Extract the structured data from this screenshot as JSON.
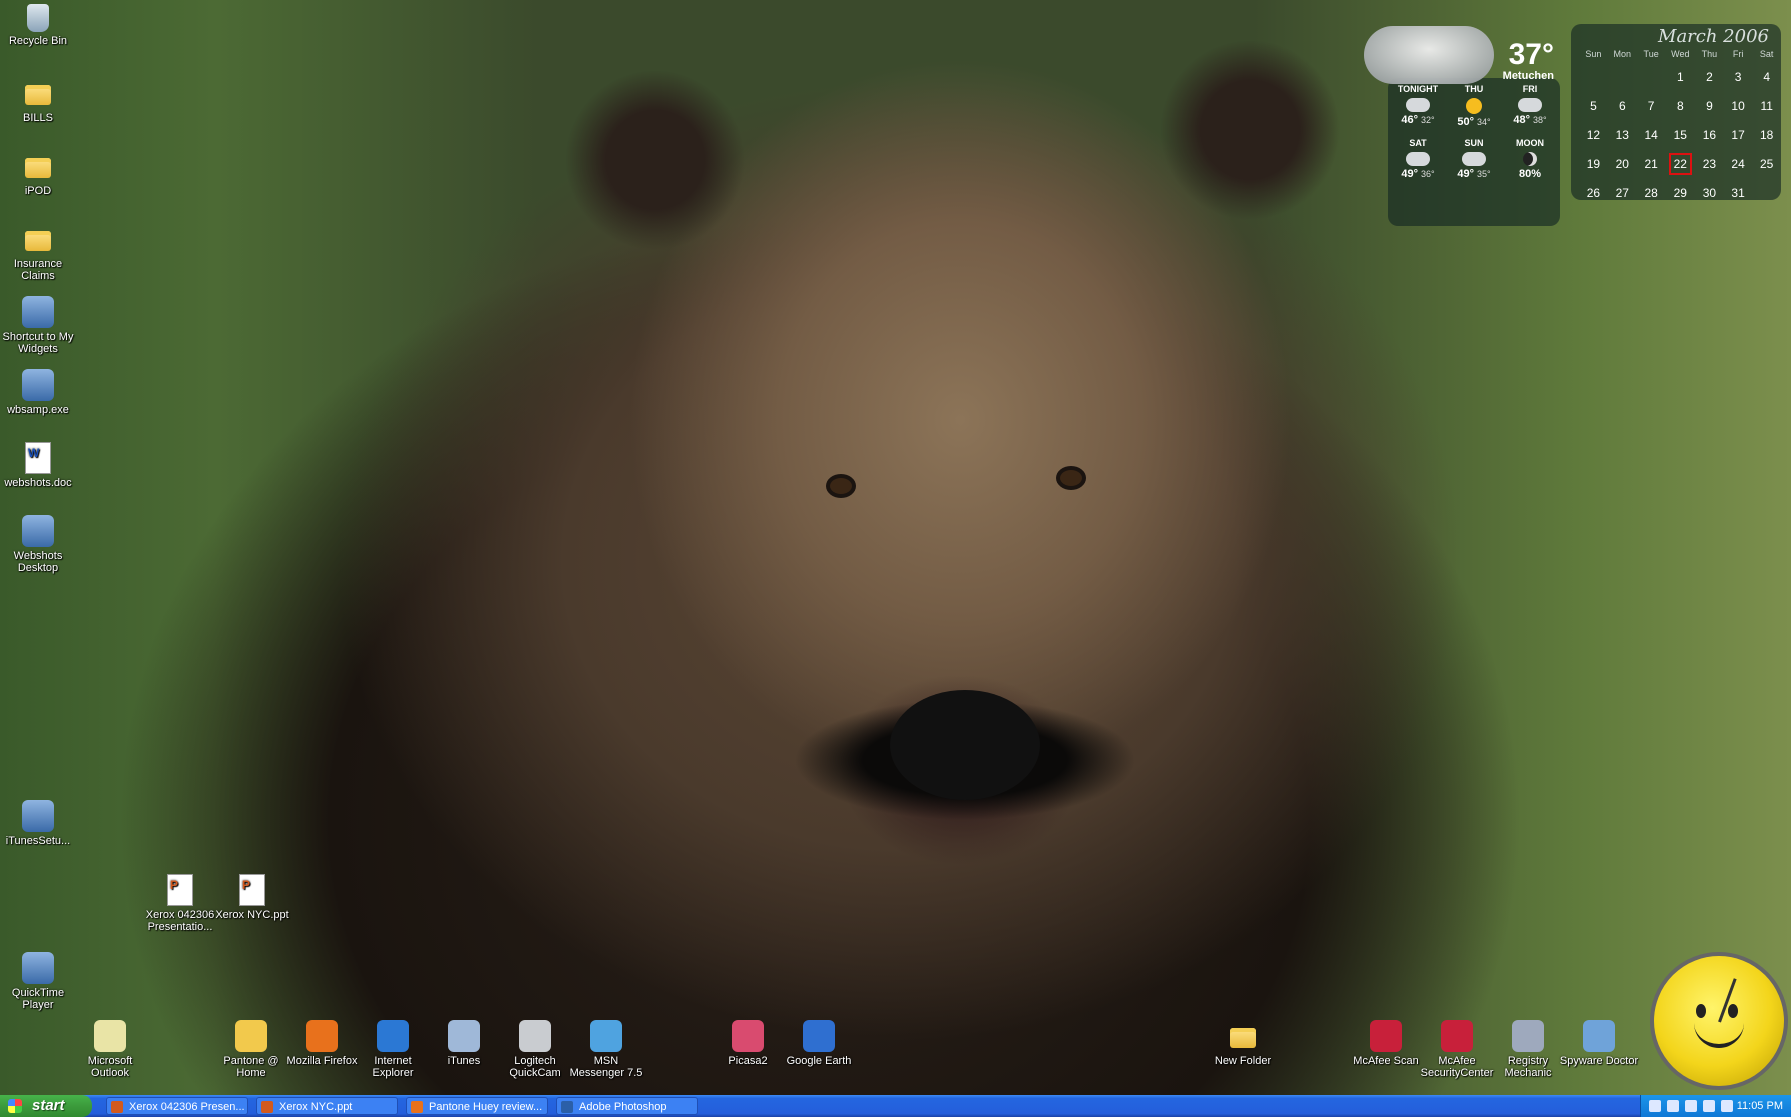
{
  "desktop_left": [
    {
      "name": "recycle-bin",
      "label": "Recycle Bin",
      "kind": "bin"
    },
    {
      "name": "bills-folder",
      "label": "BILLS",
      "kind": "folder"
    },
    {
      "name": "ipod-folder",
      "label": "iPOD",
      "kind": "folder"
    },
    {
      "name": "insurance-claims-folder",
      "label": "Insurance Claims",
      "kind": "folder"
    },
    {
      "name": "my-widgets-shortcut",
      "label": "Shortcut to My Widgets",
      "kind": "app"
    },
    {
      "name": "wbsamp-exe",
      "label": "wbsamp.exe",
      "kind": "app"
    },
    {
      "name": "websots-doc",
      "label": "webshots.doc",
      "kind": "doc-word"
    },
    {
      "name": "webshots-desktop",
      "label": "Webshots Desktop",
      "kind": "app"
    },
    {
      "name": "itunes-setup",
      "label": "iTunesSetu...",
      "kind": "app"
    },
    {
      "name": "quicktime-player",
      "label": "QuickTime Player",
      "kind": "app"
    }
  ],
  "desktop_files": [
    {
      "name": "xerox-042306-presentation",
      "label": "Xerox 042306 Presentatio...",
      "kind": "doc-ppt"
    },
    {
      "name": "xerox-nyc-ppt",
      "label": "Xerox NYC.ppt",
      "kind": "doc-ppt"
    }
  ],
  "desktop_bottom": [
    {
      "name": "microsoft-outlook",
      "label": "Microsoft Outlook",
      "color": "#e9e4a6"
    },
    {
      "name": "pantone-at-home",
      "label": "Pantone @ Home",
      "color": "#f2c94c"
    },
    {
      "name": "mozilla-firefox",
      "label": "Mozilla Firefox",
      "color": "#e8711c"
    },
    {
      "name": "internet-explorer",
      "label": "Internet Explorer",
      "color": "#2b78d4"
    },
    {
      "name": "itunes",
      "label": "iTunes",
      "color": "#9fb8d8"
    },
    {
      "name": "logitech-quickcam",
      "label": "Logitech QuickCam",
      "color": "#c9ccd0"
    },
    {
      "name": "msn-messenger",
      "label": "MSN Messenger 7.5",
      "color": "#4fa3e0"
    },
    {
      "name": "picasa2",
      "label": "Picasa2",
      "color": "#d94b6f"
    },
    {
      "name": "google-earth",
      "label": "Google Earth",
      "color": "#2f6fd0"
    },
    {
      "name": "new-folder",
      "label": "New Folder",
      "color": "#f0c83c"
    },
    {
      "name": "mcafee-scan",
      "label": "McAfee Scan",
      "color": "#c8203a"
    },
    {
      "name": "mcafee-securitycenter",
      "label": "McAfee SecurityCenter",
      "color": "#c8203a"
    },
    {
      "name": "registry-mechanic",
      "label": "Registry Mechanic",
      "color": "#9ea9bd"
    },
    {
      "name": "spyware-doctor",
      "label": "Spyware Doctor",
      "color": "#6fa3d9"
    }
  ],
  "weather": {
    "temp": "37°",
    "location": "Metuchen",
    "days": [
      {
        "label": "TONIGHT",
        "icon": "cloud-icon",
        "hi": "46°",
        "lo": "32°"
      },
      {
        "label": "THU",
        "icon": "sun-icon",
        "hi": "50°",
        "lo": "34°"
      },
      {
        "label": "FRI",
        "icon": "cloud-icon",
        "hi": "48°",
        "lo": "38°"
      },
      {
        "label": "SAT",
        "icon": "cloud-icon",
        "hi": "49°",
        "lo": "36°"
      },
      {
        "label": "SUN",
        "icon": "rain-icon",
        "hi": "49°",
        "lo": "35°"
      },
      {
        "label": "MOON",
        "icon": "moon-icon",
        "hi": "80%",
        "lo": ""
      }
    ]
  },
  "calendar": {
    "title": "March 2006",
    "weekdays": [
      "Sun",
      "Mon",
      "Tue",
      "Wed",
      "Thu",
      "Fri",
      "Sat"
    ],
    "weeks": [
      [
        "",
        "",
        "",
        "1",
        "2",
        "3",
        "4"
      ],
      [
        "5",
        "6",
        "7",
        "8",
        "9",
        "10",
        "11"
      ],
      [
        "12",
        "13",
        "14",
        "15",
        "16",
        "17",
        "18"
      ],
      [
        "19",
        "20",
        "21",
        "22",
        "23",
        "24",
        "25"
      ],
      [
        "26",
        "27",
        "28",
        "29",
        "30",
        "31",
        ""
      ]
    ],
    "today": "22"
  },
  "taskbar": {
    "start_label": "start",
    "buttons": [
      {
        "name": "task-xerox-presentation",
        "label": "Xerox 042306 Presen...",
        "color": "#d35a1f"
      },
      {
        "name": "task-xerox-nyc",
        "label": "Xerox NYC.ppt",
        "color": "#d35a1f"
      },
      {
        "name": "task-pantone-huey",
        "label": "Pantone Huey review...",
        "color": "#e8711c"
      },
      {
        "name": "task-adobe-photoshop",
        "label": "Adobe Photoshop",
        "color": "#2b5fa8"
      }
    ],
    "clock": "11:05 PM"
  }
}
